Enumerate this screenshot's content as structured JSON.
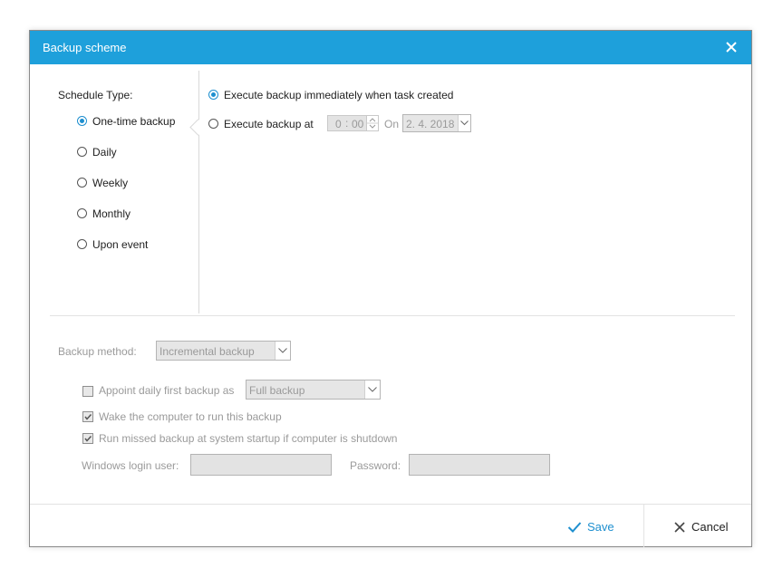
{
  "dialog": {
    "title": "Backup scheme",
    "close_icon": "close-icon"
  },
  "schedule": {
    "label": "Schedule Type:",
    "options": [
      {
        "label": "One-time backup",
        "selected": true
      },
      {
        "label": "Daily",
        "selected": false
      },
      {
        "label": "Weekly",
        "selected": false
      },
      {
        "label": "Monthly",
        "selected": false
      },
      {
        "label": "Upon event",
        "selected": false
      }
    ]
  },
  "execute": {
    "immediate_label": "Execute backup immediately when task created",
    "at_label": "Execute backup at",
    "hour": "0",
    "minute": "00",
    "on_label": "On",
    "date": "2. 4. 2018"
  },
  "method": {
    "label": "Backup method:",
    "value": "Incremental backup"
  },
  "options": {
    "appoint_label": "Appoint daily first backup as",
    "appoint_value": "Full backup",
    "wake_label": "Wake the computer to run this backup",
    "missed_label": "Run missed backup at system startup if computer is shutdown",
    "login_label": "Windows login user:",
    "password_label": "Password:"
  },
  "footer": {
    "save_label": "Save",
    "cancel_label": "Cancel"
  },
  "colors": {
    "accent": "#1ea0db",
    "radio_accent": "#1e8fcf"
  }
}
